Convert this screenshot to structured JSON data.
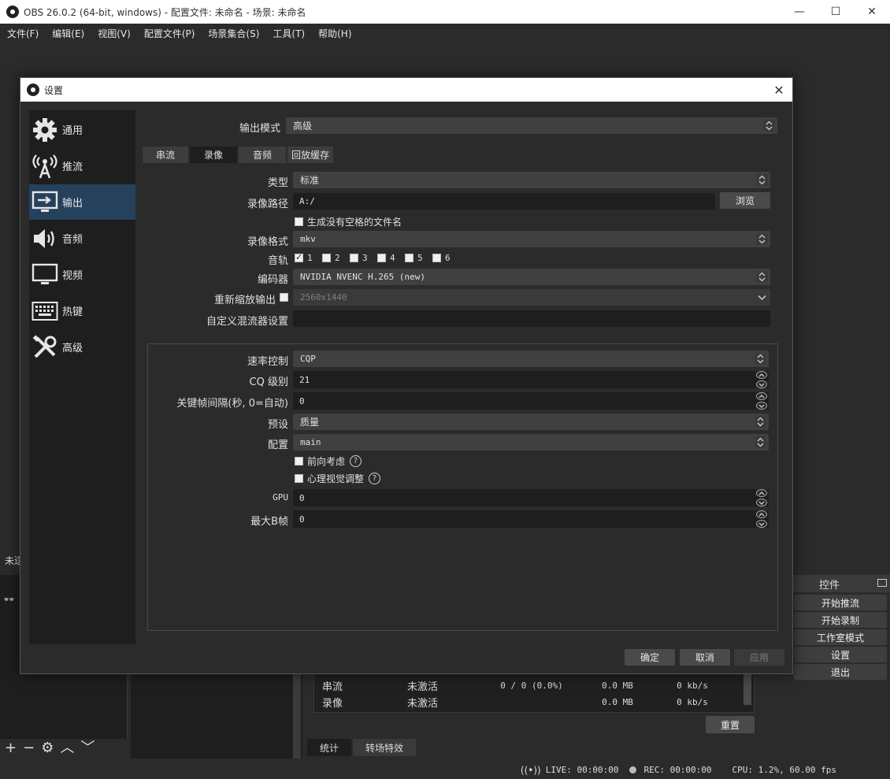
{
  "main_window": {
    "title": "OBS 26.0.2 (64-bit, windows) - 配置文件: 未命名 - 场景: 未命名",
    "menu": [
      "文件(F)",
      "编辑(E)",
      "视图(V)",
      "配置文件(P)",
      "场景集合(S)",
      "工具(T)",
      "帮助(H)"
    ],
    "left_label": "未送",
    "stats": {
      "rows": [
        {
          "name": "串流",
          "status": "未激活",
          "dropped": "0 / 0 (0.0%)",
          "size": "0.0 MB",
          "bitrate": "0 kb/s"
        },
        {
          "name": "录像",
          "status": "未激活",
          "dropped": "",
          "size": "0.0 MB",
          "bitrate": "0 kb/s"
        }
      ],
      "reset_label": "重置"
    },
    "dock_tabs": [
      "统计",
      "转场特效"
    ],
    "controls": {
      "header": "控件",
      "buttons": [
        "开始推流",
        "开始录制",
        "工作室模式",
        "设置",
        "退出"
      ]
    },
    "status_bar": {
      "live": "LIVE: 00:00:00",
      "rec": "REC: 00:00:00",
      "cpu": "CPU: 1.2%, 60.00 fps"
    },
    "scene_toolbar": [
      "+",
      "−",
      "⚙",
      "︿",
      "﹀"
    ]
  },
  "dialog": {
    "title": "设置",
    "nav": [
      {
        "label": "通用",
        "icon": "gear-icon"
      },
      {
        "label": "推流",
        "icon": "broadcast-icon"
      },
      {
        "label": "输出",
        "icon": "output-icon",
        "active": true
      },
      {
        "label": "音频",
        "icon": "speaker-icon"
      },
      {
        "label": "视频",
        "icon": "monitor-icon"
      },
      {
        "label": "热键",
        "icon": "keyboard-icon"
      },
      {
        "label": "高级",
        "icon": "tools-icon"
      }
    ],
    "output_mode": {
      "label": "输出模式",
      "value": "高级"
    },
    "tabs": [
      "串流",
      "录像",
      "音频",
      "回放缓存"
    ],
    "active_tab": "录像",
    "recording": {
      "type_label": "类型",
      "type_value": "标准",
      "path_label": "录像路径",
      "path_value": "A:/",
      "browse_label": "浏览",
      "no_space_label": "生成没有空格的文件名",
      "format_label": "录像格式",
      "format_value": "mkv",
      "tracks_label": "音轨",
      "tracks": [
        {
          "n": "1",
          "checked": true
        },
        {
          "n": "2",
          "checked": false
        },
        {
          "n": "3",
          "checked": false
        },
        {
          "n": "4",
          "checked": false
        },
        {
          "n": "5",
          "checked": false
        },
        {
          "n": "6",
          "checked": false
        }
      ],
      "encoder_label": "编码器",
      "encoder_value": "NVIDIA NVENC H.265 (new)",
      "rescale_label": "重新缩放输出",
      "rescale_value": "2560x1440",
      "muxer_label": "自定义混流器设置",
      "muxer_value": ""
    },
    "encoder_settings": {
      "rate_control_label": "速率控制",
      "rate_control_value": "CQP",
      "cq_label": "CQ 级别",
      "cq_value": "21",
      "keyint_label": "关键帧间隔(秒, 0=自动)",
      "keyint_value": "0",
      "preset_label": "预设",
      "preset_value": "质量",
      "profile_label": "配置",
      "profile_value": "main",
      "lookahead_label": "前向考虑",
      "psycho_label": "心理视觉调整",
      "gpu_label": "GPU",
      "gpu_value": "0",
      "bframes_label": "最大B帧",
      "bframes_value": "0"
    },
    "buttons": {
      "ok": "确定",
      "cancel": "取消",
      "apply": "应用"
    }
  }
}
